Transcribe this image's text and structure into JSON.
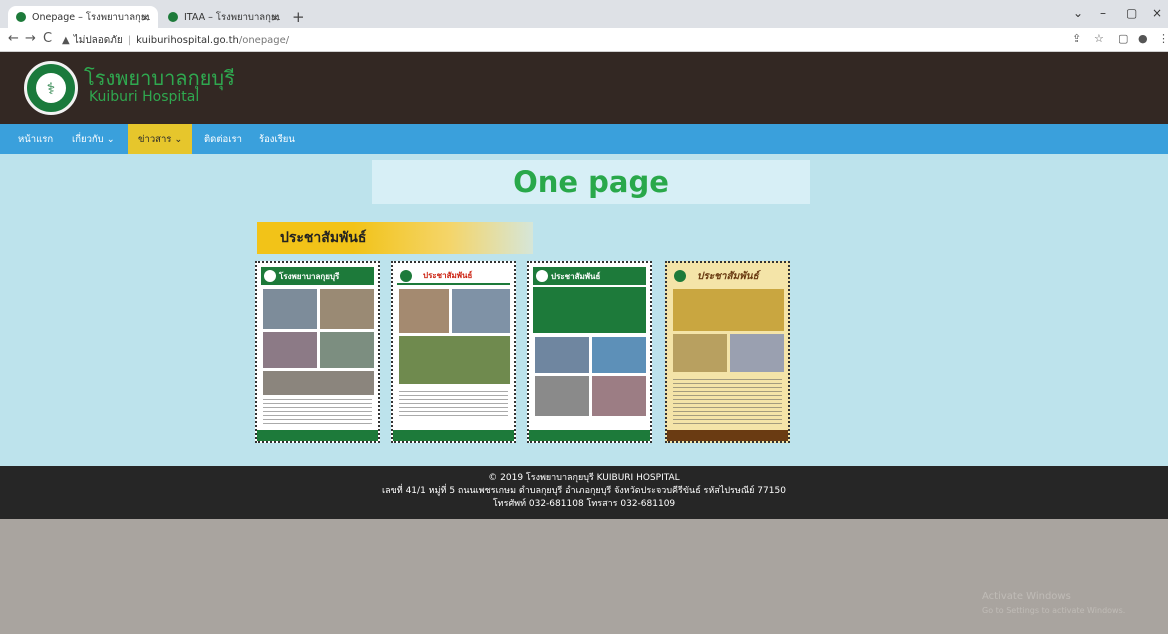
{
  "browser": {
    "tabs": [
      {
        "title": "Onepage – โรงพยาบาลกุยบุรี",
        "close": "×"
      },
      {
        "title": "ITAA – โรงพยาบาลกุยบุรี",
        "close": "×"
      }
    ],
    "new_tab": "+",
    "window_controls": [
      "⌄",
      "–",
      "▢",
      "×"
    ],
    "nav": {
      "back": "←",
      "forward": "→",
      "reload": "C"
    },
    "address": {
      "security_label": "ไม่ปลอดภัย",
      "separator": "|",
      "domain": "kuiburihospital.go.th",
      "path": "/onepage/"
    },
    "right_icons": [
      "⇪",
      "☆",
      "▢",
      "●",
      "⋮"
    ]
  },
  "site": {
    "name_th": "โรงพยาบาลกุยบุรี",
    "name_en": "Kuiburi Hospital",
    "logo_icon": "⚕",
    "nav": [
      {
        "label": "หน้าแรก"
      },
      {
        "label": "เกี่ยวกับ ⌄"
      },
      {
        "label": "ข่าวสาร ⌄"
      },
      {
        "label": "ติดต่อเรา"
      },
      {
        "label": "ร้องเรียน"
      }
    ],
    "page_title": "One page",
    "section_heading": "ประชาสัมพันธ์",
    "posters": [
      {
        "heading": "โรงพยาบาลกุยบุรี"
      },
      {
        "heading": "ประชาสัมพันธ์"
      },
      {
        "heading": "ประชาสัมพันธ์"
      },
      {
        "heading": "ประชาสัมพันธ์"
      }
    ]
  },
  "footer": {
    "line1": "© 2019 โรงพยาบาลกุยบุรี KUIBURI HOSPITAL",
    "line2": "เลขที่ 41/1 หมู่ที่ 5 ถนนเพชรเกษม ตำบลกุยบุรี อำเภอกุยบุรี จังหวัดประจวบคีรีขันธ์ รหัสไปรษณีย์ 77150",
    "line3": "โทรศัพท์ 032-681108 โทรสาร 032-681109"
  },
  "os_overlay": {
    "line1": "Activate Windows",
    "line2": "Go to Settings to activate Windows."
  },
  "colors": {
    "header_bg": "#332823",
    "nav_bg": "#3aa0dc",
    "nav_active": "#e6c62c",
    "content_bg": "#bde3ec",
    "brand_green": "#29a84a",
    "footer_bg": "#262626"
  }
}
